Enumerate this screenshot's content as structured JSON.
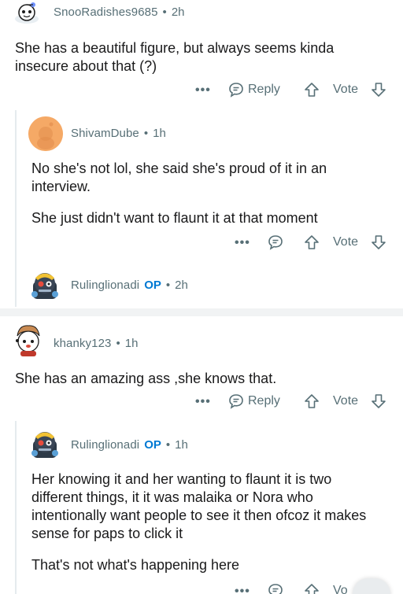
{
  "comments": [
    {
      "username": "SnooRadishes9685",
      "time": "2h",
      "body": [
        "She has a beautiful figure, but always seems kinda insecure about that (?)"
      ],
      "actions": {
        "more": "•••",
        "reply": "Reply",
        "vote": "Vote"
      }
    },
    {
      "username": "ShivamDube",
      "time": "1h",
      "body": [
        "No she's not lol, she said she's proud of it in an interview.",
        "She just didn't want to flaunt it at that moment"
      ],
      "actions": {
        "more": "•••",
        "vote": "Vote"
      }
    },
    {
      "username": "Rulinglionadi",
      "op": "OP",
      "time": "2h"
    },
    {
      "username": "khanky123",
      "time": "1h",
      "body": [
        "She has an amazing ass ,she knows that."
      ],
      "actions": {
        "more": "•••",
        "reply": "Reply",
        "vote": "Vote"
      }
    },
    {
      "username": "Rulinglionadi",
      "op": "OP",
      "time": "1h",
      "body": [
        "Her knowing it and her wanting to flaunt it is two different things, it it was malaika or Nora who intentionally want people to see it then ofcoz it makes sense for paps to click it",
        "That's not what's happening here"
      ],
      "actions": {
        "more": "•••",
        "vote": "Vo"
      }
    }
  ],
  "separator_dot": "•",
  "colors": {
    "op": "#0079d3",
    "meta": "#576f76",
    "text": "#1a1a1b",
    "thread": "#e5ebee"
  }
}
